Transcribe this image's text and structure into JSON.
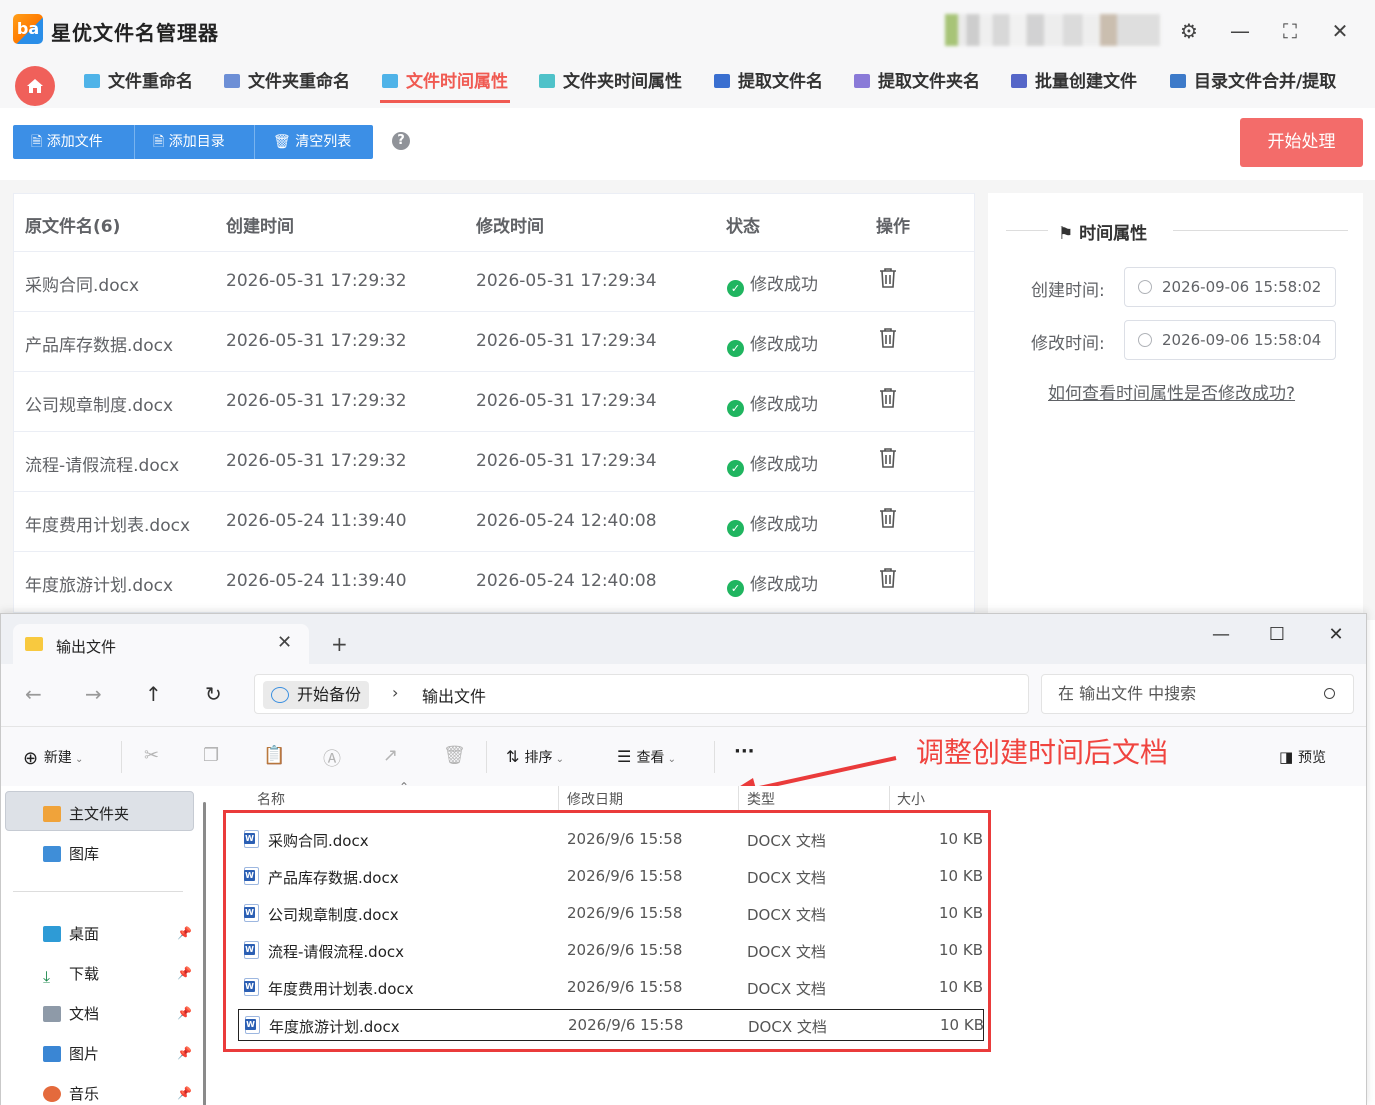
{
  "app": {
    "title": "星优文件名管理器",
    "logo_text": "ba"
  },
  "window_controls": [
    "⚙",
    "—",
    "⛶",
    "✕"
  ],
  "nav": {
    "tabs": [
      {
        "label": "文件重命名",
        "active": false
      },
      {
        "label": "文件夹重命名",
        "active": false
      },
      {
        "label": "文件时间属性",
        "active": true
      },
      {
        "label": "文件夹时间属性",
        "active": false
      },
      {
        "label": "提取文件名",
        "active": false
      },
      {
        "label": "提取文件夹名",
        "active": false
      },
      {
        "label": "批量创建文件",
        "active": false
      },
      {
        "label": "目录文件合并/提取",
        "active": false
      }
    ]
  },
  "toolbar": {
    "add_file": "添加文件",
    "add_dir": "添加目录",
    "clear_list": "清空列表",
    "help": "?",
    "start": "开始处理"
  },
  "table": {
    "headers": [
      "原文件名(6)",
      "创建时间",
      "修改时间",
      "状态",
      "操作"
    ],
    "rows": [
      {
        "name": "采购合同.docx",
        "created": "2026-05-31 17:29:32",
        "modified": "2026-05-31 17:29:34",
        "status": "修改成功"
      },
      {
        "name": "产品库存数据.docx",
        "created": "2026-05-31 17:29:32",
        "modified": "2026-05-31 17:29:34",
        "status": "修改成功"
      },
      {
        "name": "公司规章制度.docx",
        "created": "2026-05-31 17:29:32",
        "modified": "2026-05-31 17:29:34",
        "status": "修改成功"
      },
      {
        "name": "流程-请假流程.docx",
        "created": "2026-05-31 17:29:32",
        "modified": "2026-05-31 17:29:34",
        "status": "修改成功"
      },
      {
        "name": "年度费用计划表.docx",
        "created": "2026-05-24 11:39:40",
        "modified": "2026-05-24 12:40:08",
        "status": "修改成功"
      },
      {
        "name": "年度旅游计划.docx",
        "created": "2026-05-24 11:39:40",
        "modified": "2026-05-24 12:40:08",
        "status": "修改成功"
      }
    ]
  },
  "panel": {
    "title": "时间属性",
    "created_label": "创建时间:",
    "created_value": "2026-09-06 15:58:02",
    "modified_label": "修改时间:",
    "modified_value": "2026-09-06 15:58:04",
    "help_link": "如何查看时间属性是否修改成功?"
  },
  "explorer": {
    "tab_title": "输出文件",
    "tab_close": "✕",
    "new_tab": "+",
    "window_controls": [
      "—",
      "☐",
      "✕"
    ],
    "breadcrumb": [
      "开始备份",
      "输出文件"
    ],
    "breadcrumb_sep": "›",
    "search_placeholder": "在 输出文件 中搜索",
    "commands": {
      "new": "新建",
      "sort": "排序",
      "view": "查看",
      "more": "···",
      "preview": "预览"
    },
    "annotation": "调整创建时间后文档",
    "sidebar": {
      "home": "主文件夹",
      "gallery": "图库",
      "desktop": "桌面",
      "downloads": "下载",
      "documents": "文档",
      "pictures": "图片",
      "music": "音乐"
    },
    "columns": [
      "名称",
      "修改日期",
      "类型",
      "大小"
    ],
    "files": [
      {
        "name": "采购合同.docx",
        "date": "2026/9/6 15:58",
        "type": "DOCX 文档",
        "size": "10 KB"
      },
      {
        "name": "产品库存数据.docx",
        "date": "2026/9/6 15:58",
        "type": "DOCX 文档",
        "size": "10 KB"
      },
      {
        "name": "公司规章制度.docx",
        "date": "2026/9/6 15:58",
        "type": "DOCX 文档",
        "size": "10 KB"
      },
      {
        "name": "流程-请假流程.docx",
        "date": "2026/9/6 15:58",
        "type": "DOCX 文档",
        "size": "10 KB"
      },
      {
        "name": "年度费用计划表.docx",
        "date": "2026/9/6 15:58",
        "type": "DOCX 文档",
        "size": "10 KB"
      },
      {
        "name": "年度旅游计划.docx",
        "date": "2026/9/6 15:58",
        "type": "DOCX 文档",
        "size": "10 KB"
      }
    ]
  },
  "colors": {
    "accent": "#f05a52",
    "primary": "#3c8fe6",
    "success": "#20b560",
    "annotation": "#ea3b3b"
  }
}
